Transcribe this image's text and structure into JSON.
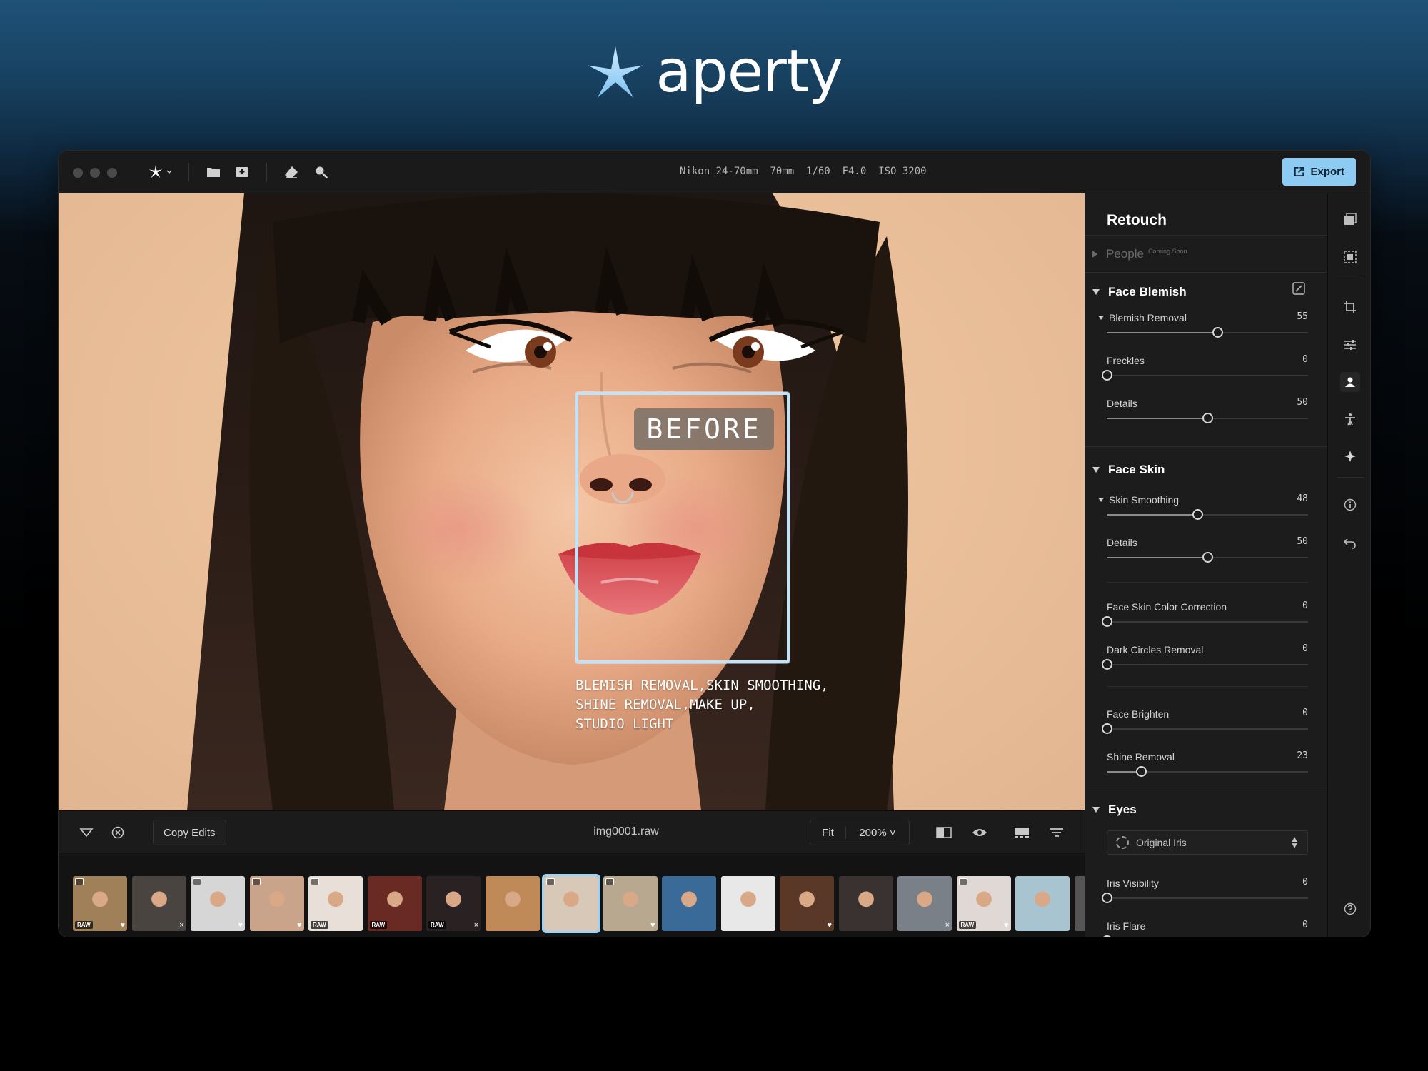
{
  "brand": {
    "name": "aperty",
    "accent": "#8ecbf2"
  },
  "titlebar": {
    "camera_info": "Nikon 24-70mm  70mm  1/60  F4.0  ISO 3200",
    "export_label": "Export",
    "tools": [
      "aperty-menu-icon",
      "folder-icon",
      "import-icon",
      "eraser-icon",
      "search-icon"
    ]
  },
  "canvas": {
    "before_label": "BEFORE",
    "caption": "BLEMISH REMOVAL,SKIN SMOOTHING,\nSHINE REMOVAL,MAKE UP,\nSTUDIO LIGHT"
  },
  "bottombar": {
    "copy_edits_label": "Copy Edits",
    "filename": "img0001.raw",
    "fit_label": "Fit",
    "zoom_label": "200% ˅"
  },
  "filmstrip": {
    "thumbs": [
      {
        "tag": "RAW",
        "mark": "♥",
        "bg": "#a08058",
        "badge": true
      },
      {
        "tag": "",
        "mark": "×",
        "bg": "#4a4440",
        "badge": false
      },
      {
        "tag": "",
        "mark": "♥",
        "bg": "#d6d6d6",
        "badge": true
      },
      {
        "tag": "",
        "mark": "♥",
        "bg": "#caa48a",
        "badge": true
      },
      {
        "tag": "RAW",
        "mark": "",
        "bg": "#e8e0d8",
        "badge": true
      },
      {
        "tag": "RAW",
        "mark": "",
        "bg": "#6a2a24",
        "badge": false
      },
      {
        "tag": "RAW",
        "mark": "×",
        "bg": "#2a2222",
        "badge": false
      },
      {
        "tag": "",
        "mark": "",
        "bg": "#c08a58",
        "badge": false
      },
      {
        "tag": "",
        "mark": "",
        "bg": "#d8c8b8",
        "badge": true,
        "selected": true
      },
      {
        "tag": "",
        "mark": "♥",
        "bg": "#b8a890",
        "badge": true
      },
      {
        "tag": "",
        "mark": "",
        "bg": "#3a6a98",
        "badge": false
      },
      {
        "tag": "",
        "mark": "",
        "bg": "#e8e8e8",
        "badge": false
      },
      {
        "tag": "",
        "mark": "♥",
        "bg": "#5a3828",
        "badge": false
      },
      {
        "tag": "",
        "mark": "",
        "bg": "#3a3230",
        "badge": false
      },
      {
        "tag": "",
        "mark": "×",
        "bg": "#7a8088",
        "badge": false
      },
      {
        "tag": "RAW",
        "mark": "♥",
        "bg": "#e0d8d4",
        "badge": true
      },
      {
        "tag": "",
        "mark": "",
        "bg": "#a8c4d0",
        "badge": false
      },
      {
        "tag": "",
        "mark": "",
        "bg": "#555",
        "badge": false
      }
    ]
  },
  "panel": {
    "title": "Retouch",
    "people": {
      "label": "People",
      "soon": "Coming Soon"
    },
    "face_blemish": {
      "title": "Face Blemish",
      "sliders": [
        {
          "label": "Blemish Removal",
          "value": "55",
          "pct": 55,
          "expandable": true
        },
        {
          "label": "Freckles",
          "value": "0",
          "pct": 0
        },
        {
          "label": "Details",
          "value": "50",
          "pct": 50
        }
      ]
    },
    "face_skin": {
      "title": "Face Skin",
      "sliders": [
        {
          "label": "Skin Smoothing",
          "value": "48",
          "pct": 45,
          "expandable": true
        },
        {
          "label": "Details",
          "value": "50",
          "pct": 50
        },
        {
          "label": "Face Skin Color Correction",
          "value": "0",
          "pct": 0
        },
        {
          "label": "Dark Circles Removal",
          "value": "0",
          "pct": 0
        },
        {
          "label": "Face Brighten",
          "value": "0",
          "pct": 0
        },
        {
          "label": "Shine Removal",
          "value": "23",
          "pct": 17
        }
      ]
    },
    "eyes": {
      "title": "Eyes",
      "select_value": "Original Iris",
      "sliders": [
        {
          "label": "Iris Visibility",
          "value": "0",
          "pct": 0
        },
        {
          "label": "Iris Flare",
          "value": "0",
          "pct": 0
        }
      ]
    }
  },
  "rail": [
    "layers-icon",
    "selection-icon",
    "crop-icon",
    "adjustments-icon",
    "retouch-person-icon",
    "body-icon",
    "ai-sparkle-icon",
    "info-icon",
    "undo-icon",
    "help-icon"
  ]
}
